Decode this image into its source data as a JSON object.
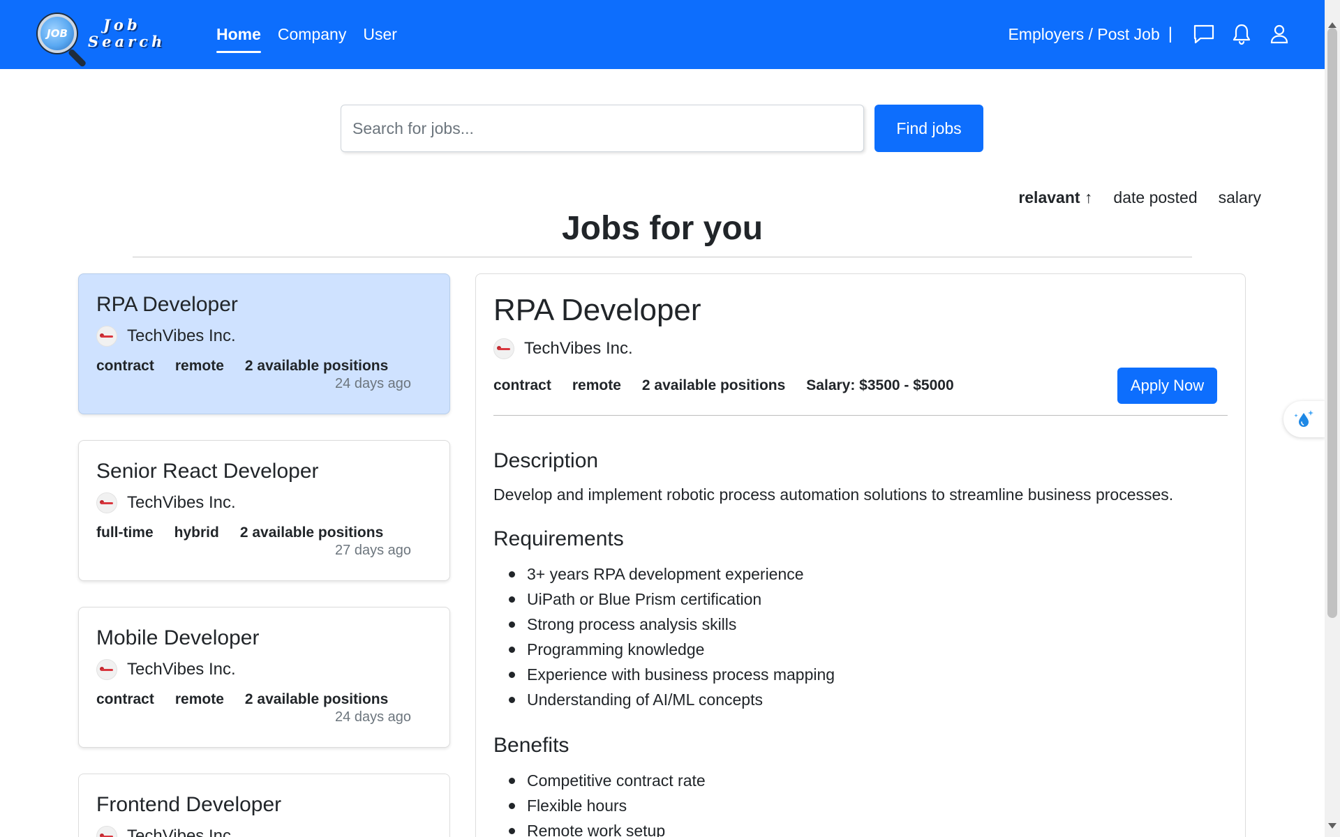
{
  "brand": {
    "logo_badge": "JOB",
    "logo_line1": "Job",
    "logo_line2": "Search"
  },
  "nav": {
    "links": [
      {
        "label": "Home",
        "active": true
      },
      {
        "label": "Company",
        "active": false
      },
      {
        "label": "User",
        "active": false
      }
    ],
    "employers_label": "Employers / Post Job",
    "separator": "|",
    "icons": [
      "chat-icon",
      "bell-icon",
      "user-icon"
    ]
  },
  "search": {
    "placeholder": "Search for jobs...",
    "value": "",
    "button_label": "Find jobs"
  },
  "sort": {
    "options": [
      "relavant ↑",
      "date posted",
      "salary"
    ],
    "active": "relavant ↑"
  },
  "page_title": "Jobs for you",
  "jobs": [
    {
      "title": "RPA Developer",
      "company": "TechVibes Inc.",
      "type": "contract",
      "location": "remote",
      "positions": "2 available positions",
      "posted": "24 days ago",
      "selected": true
    },
    {
      "title": "Senior React Developer",
      "company": "TechVibes Inc.",
      "type": "full-time",
      "location": "hybrid",
      "positions": "2 available positions",
      "posted": "27 days ago",
      "selected": false
    },
    {
      "title": "Mobile Developer",
      "company": "TechVibes Inc.",
      "type": "contract",
      "location": "remote",
      "positions": "2 available positions",
      "posted": "24 days ago",
      "selected": false
    },
    {
      "title": "Frontend Developer",
      "company": "TechVibes Inc.",
      "type": "",
      "location": "",
      "positions": "",
      "posted": "",
      "selected": false
    }
  ],
  "detail": {
    "title": "RPA Developer",
    "company": "TechVibes Inc.",
    "type": "contract",
    "location": "remote",
    "positions": "2 available positions",
    "salary": "Salary: $3500 - $5000",
    "apply_label": "Apply Now",
    "description_heading": "Description",
    "description": "Develop and implement robotic process automation solutions to streamline business processes.",
    "requirements_heading": "Requirements",
    "requirements": [
      "3+ years RPA development experience",
      "UiPath or Blue Prism certification",
      "Strong process analysis skills",
      "Programming knowledge",
      "Experience with business process mapping",
      "Understanding of AI/ML concepts"
    ],
    "benefits_heading": "Benefits",
    "benefits": [
      "Competitive contract rate",
      "Flexible hours",
      "Remote work setup"
    ]
  },
  "colors": {
    "primary": "#0d6efd",
    "selected_card": "#cfe2ff",
    "text": "#212529",
    "muted": "#6c757d"
  }
}
